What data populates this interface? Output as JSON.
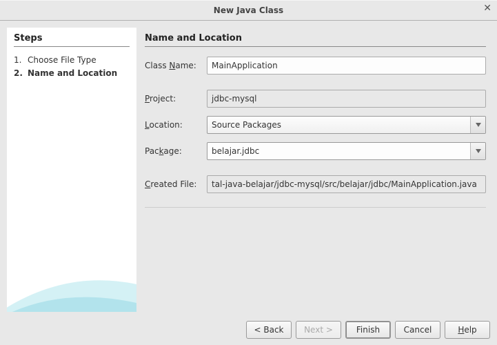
{
  "window": {
    "title": "New Java Class"
  },
  "sidebar": {
    "heading": "Steps",
    "steps": [
      {
        "num": "1.",
        "label": "Choose File Type"
      },
      {
        "num": "2.",
        "label": "Name and Location"
      }
    ],
    "active_index": 1
  },
  "main": {
    "heading": "Name and Location",
    "class_name_label": "Class Name:",
    "class_name_label_uchar": "N",
    "class_name_value": "MainApplication",
    "project_label": "Project:",
    "project_label_uchar": "P",
    "project_value": "jdbc-mysql",
    "location_label": "Location:",
    "location_label_uchar": "L",
    "location_value": "Source Packages",
    "package_label": "Package:",
    "package_label_uchar": "k",
    "package_value": "belajar.jdbc",
    "created_file_label": "Created File:",
    "created_file_label_uchar": "C",
    "created_file_value": "tal-java-belajar/jdbc-mysql/src/belajar/jdbc/MainApplication.java"
  },
  "footer": {
    "back": "< Back",
    "next": "Next >",
    "finish": "Finish",
    "cancel": "Cancel",
    "help": "Help",
    "help_uchar": "H"
  }
}
